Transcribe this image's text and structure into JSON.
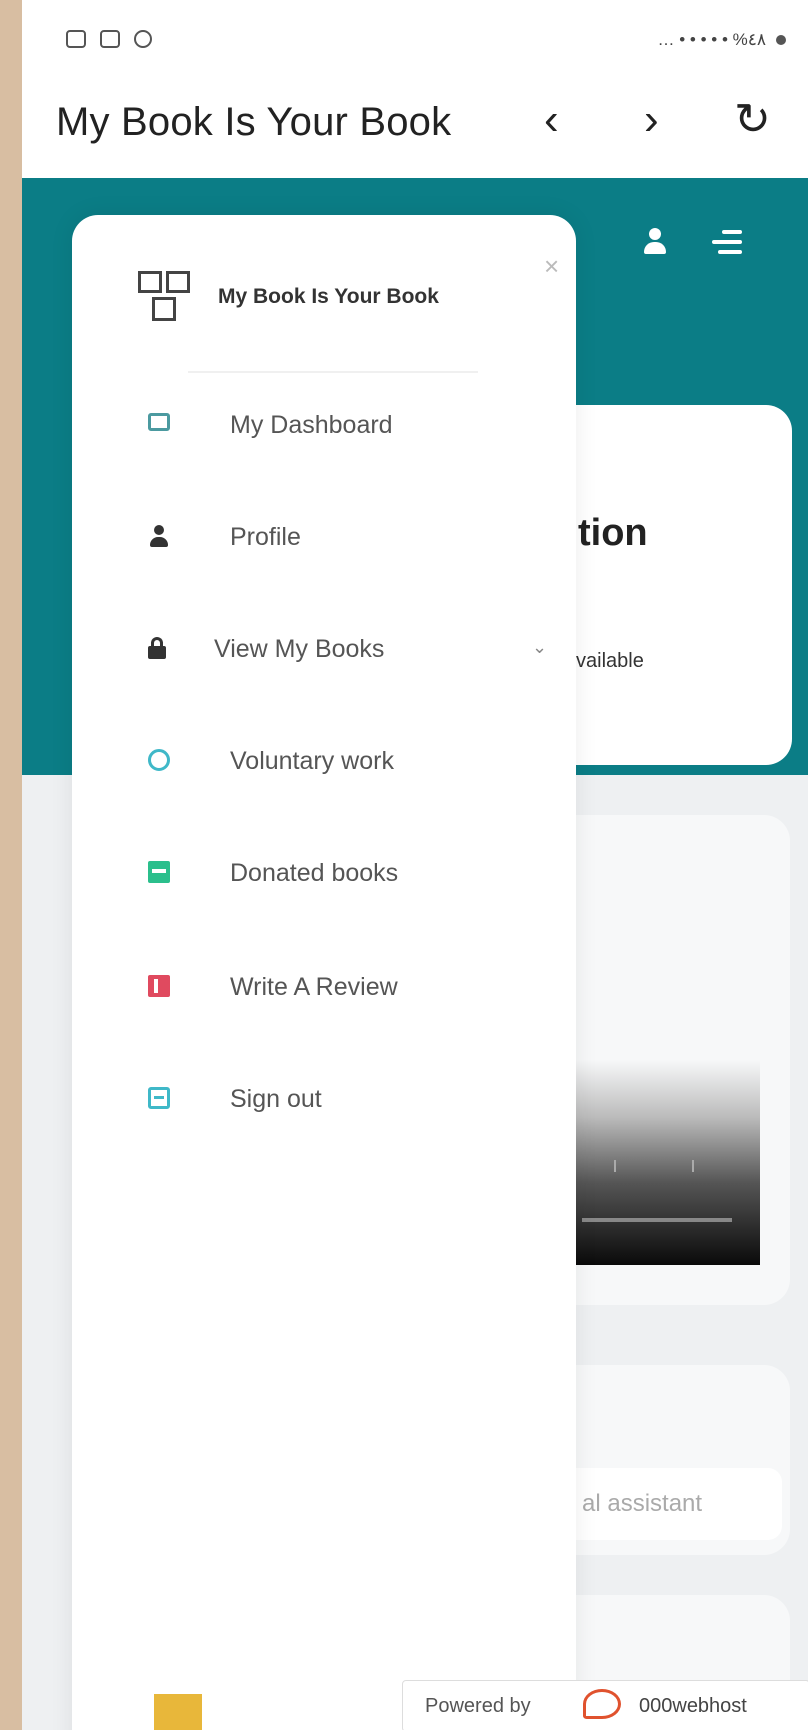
{
  "status_bar": {
    "right_text": "… • • • • • %٤٨",
    "icons": [
      "sim-icon",
      "alarm-icon",
      "wifi-icon",
      "dnd-icon",
      "signal-icon",
      "battery-icon"
    ]
  },
  "browser": {
    "title": "My Book Is Your Book",
    "back": "‹",
    "forward": "›",
    "reload": "↻"
  },
  "page": {
    "card_title": "tion",
    "card_sub": "vailable",
    "assistant_placeholder": "al assistant",
    "colors": {
      "header": "#0b7d86",
      "drawer": "#ffffff"
    }
  },
  "drawer": {
    "brand": "My Book Is Your Book",
    "close": "×",
    "items": [
      {
        "label": "My Dashboard",
        "icon": "monitor-icon",
        "color": "#4b9aa0"
      },
      {
        "label": "Profile",
        "icon": "user-icon",
        "color": "#333333"
      },
      {
        "label": "View My Books",
        "icon": "lock-icon",
        "color": "#333333",
        "expandable": true
      },
      {
        "label": "Voluntary work",
        "icon": "globe-icon",
        "color": "#3fb8c8"
      },
      {
        "label": "Donated books",
        "icon": "inbox-icon",
        "color": "#2bbf8c"
      },
      {
        "label": "Write A Review",
        "icon": "bookmark-icon",
        "color": "#e04a5f"
      },
      {
        "label": "Sign out",
        "icon": "logout-icon",
        "color": "#3fb8c8"
      }
    ],
    "chevron": "⌄"
  },
  "footer": {
    "powered_by": "Powered by",
    "brand": "000webhost"
  }
}
